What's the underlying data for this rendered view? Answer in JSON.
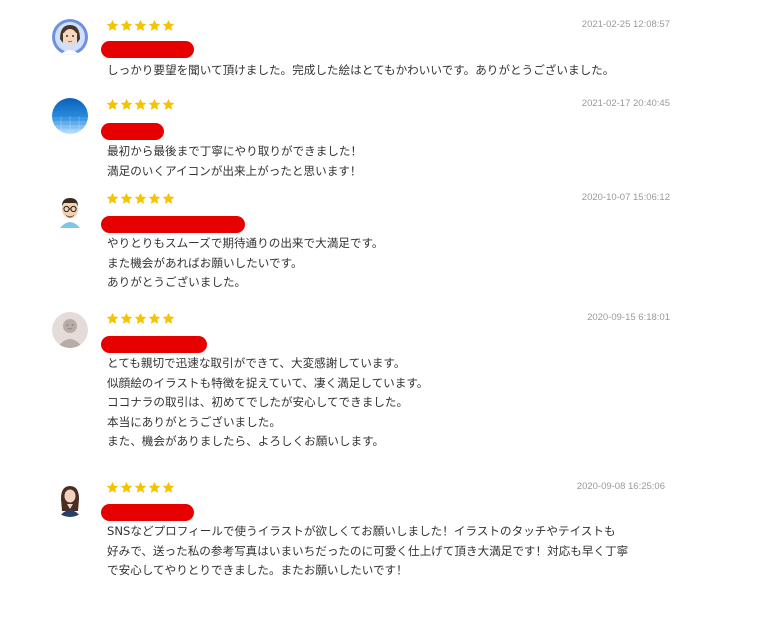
{
  "reviews": [
    {
      "avatar_icon": "woman-avatar-icon",
      "rating": 5,
      "date": "2021-02-25 12:08:57",
      "lines": [
        "しっかり要望を聞いて頂けました。完成した絵はとてもかわいいです。ありがとうございました。"
      ]
    },
    {
      "avatar_icon": "blue-gradient-avatar-icon",
      "rating": 5,
      "date": "2021-02-17 20:40:45",
      "lines": [
        "最初から最後まで丁寧にやり取りができました！",
        "満足のいくアイコンが出来上がったと思います！"
      ]
    },
    {
      "avatar_icon": "man-glasses-avatar-icon",
      "rating": 5,
      "date": "2020-10-07 15:06:12",
      "lines": [
        "やりとりもスムーズで期待通りの出来で大満足です。",
        "また機会があればお願いしたいです。",
        "ありがとうございました。"
      ]
    },
    {
      "avatar_icon": "default-user-avatar-icon",
      "rating": 5,
      "date": "2020-09-15 6:18:01",
      "lines": [
        "とても親切で迅速な取引ができて、大変感謝しています。",
        "似顔絵のイラストも特徴を捉えていて、凄く満足しています。",
        "ココナラの取引は、初めてでしたが安心してできました。",
        "本当にありがとうございました。",
        "また、機会がありましたら、よろしくお願いします。"
      ]
    },
    {
      "avatar_icon": "woman-photo-avatar-icon",
      "rating": 5,
      "date": "2020-09-08 16:25:06",
      "lines": [
        "SNSなどプロフィールで使うイラストが欲しくてお願いしました！イラストのタッチやテイストも",
        "好みで、送った私の参考写真はいまいちだったのに可愛く仕上げて頂き大満足です！対応も早く丁寧",
        "で安心してやりとりできました。またお願いしたいです！"
      ]
    }
  ],
  "colors": {
    "star": "#f5c400",
    "redaction": "#e60000",
    "date": "#9a9a9a",
    "text": "#333333"
  }
}
